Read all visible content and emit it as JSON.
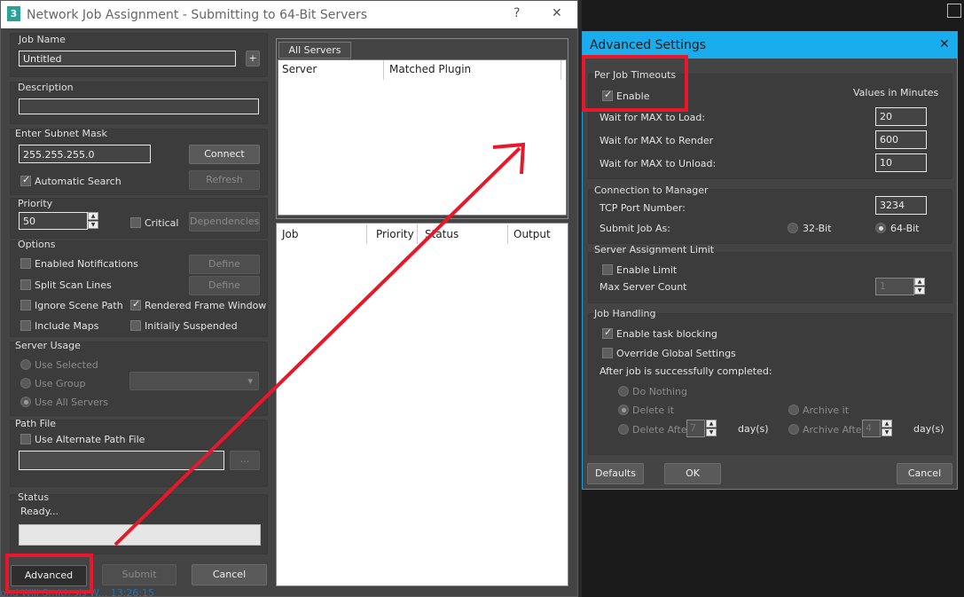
{
  "main_window": {
    "title": "Network Job Assignment - Submitting to 64-Bit Servers",
    "app_icon_text": "3",
    "help_glyph": "?",
    "close_glyph": "✕"
  },
  "job": {
    "name_label": "Job Name",
    "name_value": "Untitled",
    "add_glyph": "+",
    "description_label": "Description",
    "description_value": ""
  },
  "subnet": {
    "label": "Enter Subnet Mask",
    "value": "255.255.255.0",
    "connect_label": "Connect",
    "automatic_search_label": "Automatic Search",
    "automatic_search_checked": true,
    "refresh_label": "Refresh"
  },
  "priority": {
    "label": "Priority",
    "value": "50",
    "critical_label": "Critical",
    "dependencies_label": "Dependencies"
  },
  "options": {
    "label": "Options",
    "enabled_notifications": "Enabled Notifications",
    "define1": "Define",
    "split_scan_lines": "Split Scan Lines",
    "define2": "Define",
    "ignore_scene_path": "Ignore Scene Path",
    "rendered_frame_window": "Rendered Frame Window",
    "rendered_frame_window_checked": true,
    "include_maps": "Include Maps",
    "initially_suspended": "Initially Suspended"
  },
  "server_usage": {
    "label": "Server Usage",
    "use_selected": "Use Selected",
    "use_group": "Use Group",
    "use_all_servers": "Use All Servers"
  },
  "path_file": {
    "label": "Path File",
    "use_alternate": "Use Alternate Path File",
    "browse": "..."
  },
  "status": {
    "label": "Status",
    "text": "Ready..."
  },
  "bottom_buttons": {
    "advanced": "Advanced",
    "submit": "Submit",
    "cancel": "Cancel"
  },
  "servers_panel": {
    "tab": "All Servers",
    "columns": [
      "Server",
      "Matched Plugin"
    ]
  },
  "jobs_panel": {
    "columns": [
      "Job",
      "Priority",
      "Status",
      "Output"
    ]
  },
  "advanced_dialog": {
    "title": "Advanced Settings",
    "close_glyph": "✕",
    "timeouts": {
      "label": "Per Job Timeouts",
      "enable": "Enable",
      "enable_checked": true,
      "values_caption": "Values in Minutes",
      "load_label": "Wait for MAX to Load:",
      "load_value": "20",
      "render_label": "Wait for MAX to Render",
      "render_value": "600",
      "unload_label": "Wait for MAX to Unload:",
      "unload_value": "10"
    },
    "manager": {
      "label": "Connection to Manager",
      "tcp_label": "TCP Port Number:",
      "tcp_value": "3234",
      "submit_as_label": "Submit Job As:",
      "opt32": "32-Bit",
      "opt64": "64-Bit"
    },
    "limit": {
      "label": "Server Assignment Limit",
      "enable_limit": "Enable Limit",
      "max_count_label": "Max Server Count",
      "max_count_value": "1"
    },
    "handling": {
      "label": "Job Handling",
      "task_blocking": "Enable task blocking",
      "task_blocking_checked": true,
      "override_global": "Override Global Settings",
      "after_label": "After job is successfully completed:",
      "do_nothing": "Do Nothing",
      "delete_it": "Delete it",
      "archive_it": "Archive it",
      "delete_after": "Delete After",
      "delete_after_value": "7",
      "archive_after": "Archive After",
      "archive_after_value": "4",
      "days1": "day(s)",
      "days2": "day(s)"
    },
    "buttons": {
      "defaults": "Defaults",
      "ok": "OK",
      "cancel": "Cancel"
    }
  },
  "background": {
    "bottom_text": "ond Will Smith.sls   W... 13:26:15"
  },
  "colors": {
    "highlight": "#e8182a",
    "dialog_title": "#1aadee"
  }
}
